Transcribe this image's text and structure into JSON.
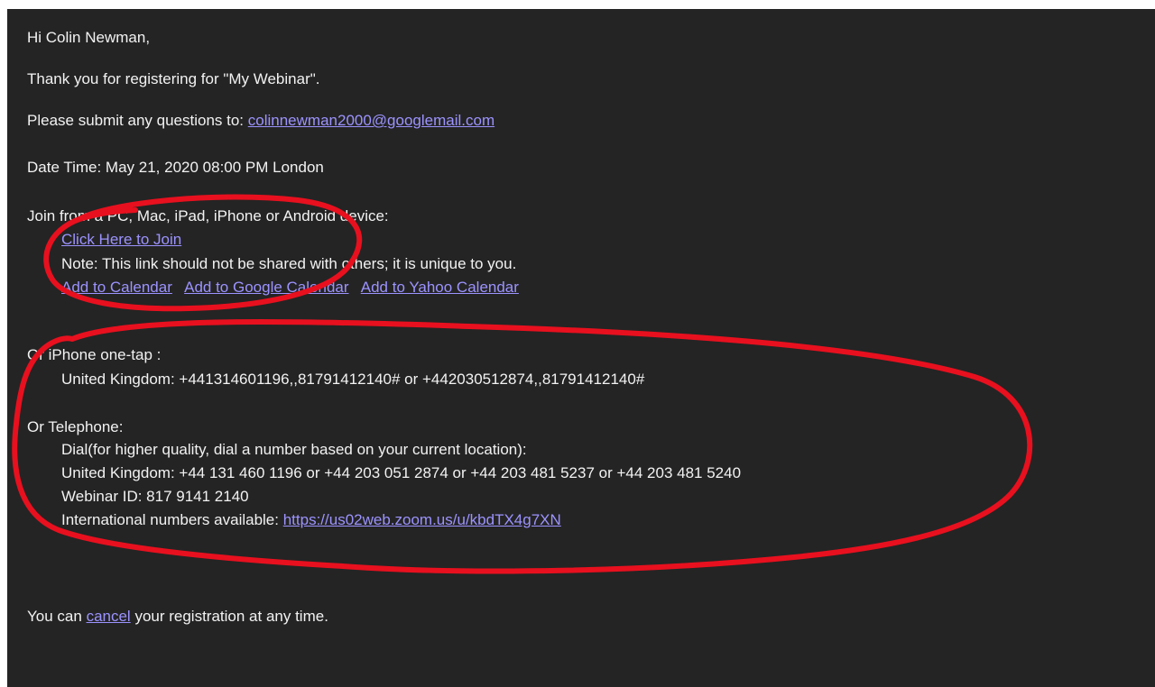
{
  "greeting": "Hi Colin Newman,",
  "thanks": "Thank you for registering for \"My Webinar\".",
  "questions": {
    "label": "Please submit any questions to:",
    "email": "colinnewman2000@googlemail.com"
  },
  "datetime": "Date Time: May 21, 2020 08:00 PM London",
  "join": {
    "heading": "Join from a PC, Mac, iPad, iPhone or Android device:",
    "join_link": "Click Here to Join",
    "note": "Note: This link should not be shared with others; it is unique to you.",
    "calendar_links": [
      "Add to Calendar",
      "Add to Google Calendar",
      "Add to Yahoo Calendar"
    ]
  },
  "iphone": {
    "heading": "Or iPhone one-tap :",
    "numbers": "United Kingdom: +441314601196,,81791412140# or +442030512874,,81791412140#"
  },
  "telephone": {
    "heading": "Or Telephone:",
    "dial_note": "Dial(for higher quality, dial a number based on your current location):",
    "numbers": "United Kingdom: +44 131 460 1196 or +44 203 051 2874 or +44 203 481 5237 or +44 203 481 5240",
    "webinar_id": "Webinar ID: 817 9141 2140",
    "intl_label": "International numbers available:",
    "intl_link": "https://us02web.zoom.us/u/kbdTX4g7XN"
  },
  "cancel": {
    "before": "You can",
    "link": "cancel",
    "after": "your registration at any time."
  },
  "colors": {
    "background": "#242424",
    "text": "#f2f2f2",
    "link": "#9c93ff",
    "annotation": "#e8101e"
  }
}
